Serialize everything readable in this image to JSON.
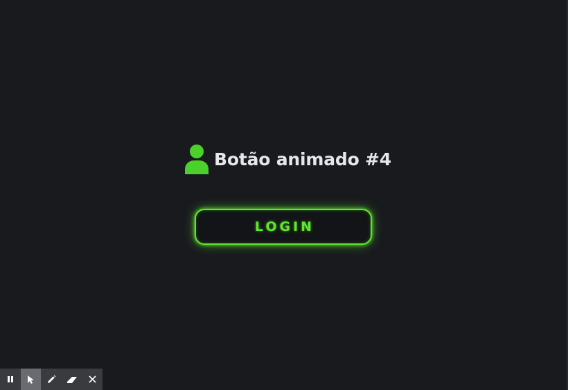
{
  "page": {
    "heading": "Botão animado #4"
  },
  "button": {
    "label": "LOGIN"
  },
  "toolbar": {
    "tools": [
      {
        "icon": "pause-icon",
        "active": false
      },
      {
        "icon": "pointer-icon",
        "active": true
      },
      {
        "icon": "pen-icon",
        "active": false
      },
      {
        "icon": "eraser-icon",
        "active": false
      },
      {
        "icon": "close-icon",
        "active": false
      }
    ]
  },
  "colors": {
    "background": "#191a1e",
    "accent": "#5de82e",
    "heading_text": "#e7e7e7",
    "toolbar": "#3a3b3f"
  }
}
